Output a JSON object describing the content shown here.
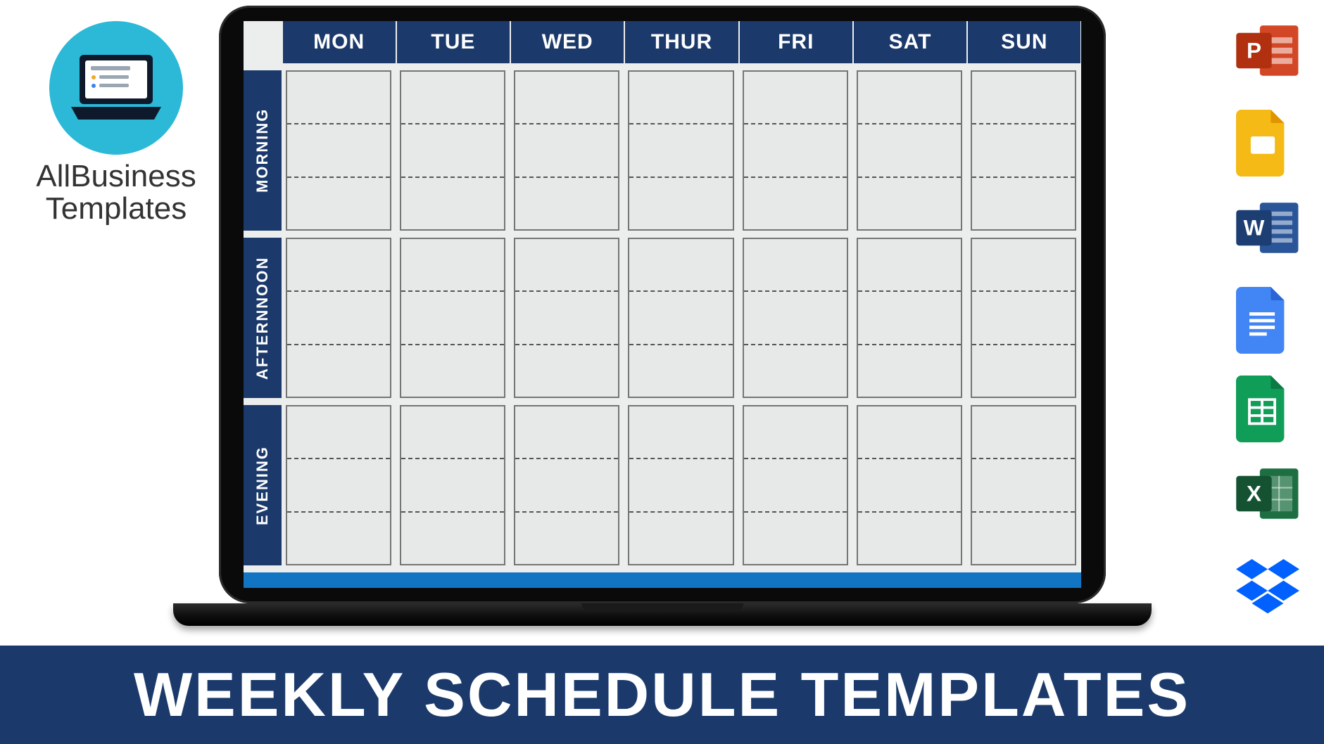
{
  "brand": {
    "line1": "AllBusiness",
    "line2": "Templates",
    "icon": "laptop-icon"
  },
  "banner": {
    "title": "WEEKLY SCHEDULE TEMPLATES"
  },
  "schedule": {
    "days": [
      "MON",
      "TUE",
      "WED",
      "THUR",
      "FRI",
      "SAT",
      "SUN"
    ],
    "periods": [
      "MORNING",
      "AFTERNNOON",
      "EVENING"
    ],
    "slots_per_period": 3
  },
  "app_icons": [
    {
      "name": "powerpoint-icon",
      "letter": "P",
      "fill": "#d24726",
      "accent": "#b03010"
    },
    {
      "name": "google-slides-icon",
      "letter": "",
      "fill": "#f5ba15",
      "accent": "#e09500"
    },
    {
      "name": "word-icon",
      "letter": "W",
      "fill": "#2a5699",
      "accent": "#1c3e73"
    },
    {
      "name": "google-docs-icon",
      "letter": "",
      "fill": "#4285f4",
      "accent": "#2a65d8"
    },
    {
      "name": "google-sheets-icon",
      "letter": "",
      "fill": "#0f9d58",
      "accent": "#0b7a44"
    },
    {
      "name": "excel-icon",
      "letter": "X",
      "fill": "#1d6f42",
      "accent": "#155232"
    },
    {
      "name": "dropbox-icon",
      "letter": "",
      "fill": "#0061ff",
      "accent": "#0061ff"
    }
  ]
}
